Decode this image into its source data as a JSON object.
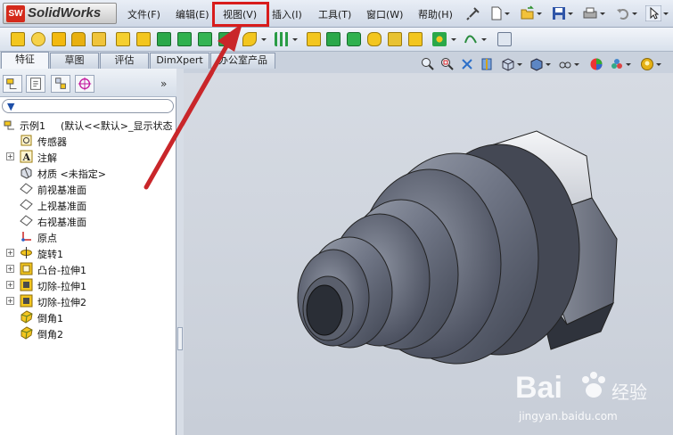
{
  "app": {
    "title": "SolidWorks",
    "logo_mark": "SW"
  },
  "menu": [
    {
      "id": "file",
      "label": "文件(F)"
    },
    {
      "id": "edit",
      "label": "编辑(E)"
    },
    {
      "id": "view",
      "label": "视图(V)"
    },
    {
      "id": "insert",
      "label": "插入(I)"
    },
    {
      "id": "tools",
      "label": "工具(T)"
    },
    {
      "id": "window",
      "label": "窗口(W)"
    },
    {
      "id": "help",
      "label": "帮助(H)"
    }
  ],
  "command_tabs": [
    {
      "label": "特征",
      "active": true
    },
    {
      "label": "草图",
      "active": false
    },
    {
      "label": "评估",
      "active": false
    },
    {
      "label": "DimXpert",
      "active": false
    },
    {
      "label": "办公室产品",
      "active": false
    }
  ],
  "feature_tree": {
    "filter_icon": "filter-icon",
    "collapse_glyph": "»",
    "root": {
      "label": "示例1",
      "config": "(默认<<默认>_显示状态",
      "icon": "part-icon"
    },
    "items": [
      {
        "label": "传感器",
        "icon": "sensor-icon",
        "expandable": false
      },
      {
        "label": "注解",
        "icon": "annotation-icon",
        "expandable": true
      },
      {
        "label": "材质 <未指定>",
        "icon": "material-icon",
        "expandable": false
      },
      {
        "label": "前视基准面",
        "icon": "plane-icon",
        "expandable": false
      },
      {
        "label": "上视基准面",
        "icon": "plane-icon",
        "expandable": false
      },
      {
        "label": "右视基准面",
        "icon": "plane-icon",
        "expandable": false
      },
      {
        "label": "原点",
        "icon": "origin-icon",
        "expandable": false
      },
      {
        "label": "旋转1",
        "icon": "revolve-icon",
        "expandable": true
      },
      {
        "label": "凸台-拉伸1",
        "icon": "extrude-icon",
        "expandable": true
      },
      {
        "label": "切除-拉伸1",
        "icon": "cut-extrude-icon",
        "expandable": true
      },
      {
        "label": "切除-拉伸2",
        "icon": "cut-extrude-icon",
        "expandable": true
      },
      {
        "label": "倒角1",
        "icon": "chamfer-icon",
        "expandable": false
      },
      {
        "label": "倒角2",
        "icon": "chamfer-icon",
        "expandable": false
      }
    ]
  },
  "watermark": {
    "brand": "Bai",
    "brand2": "经验",
    "url": "jingyan.baidu.com"
  },
  "colors": {
    "highlight": "#d81c1c",
    "arrow": "#c9262a",
    "part": "#6e7585"
  }
}
